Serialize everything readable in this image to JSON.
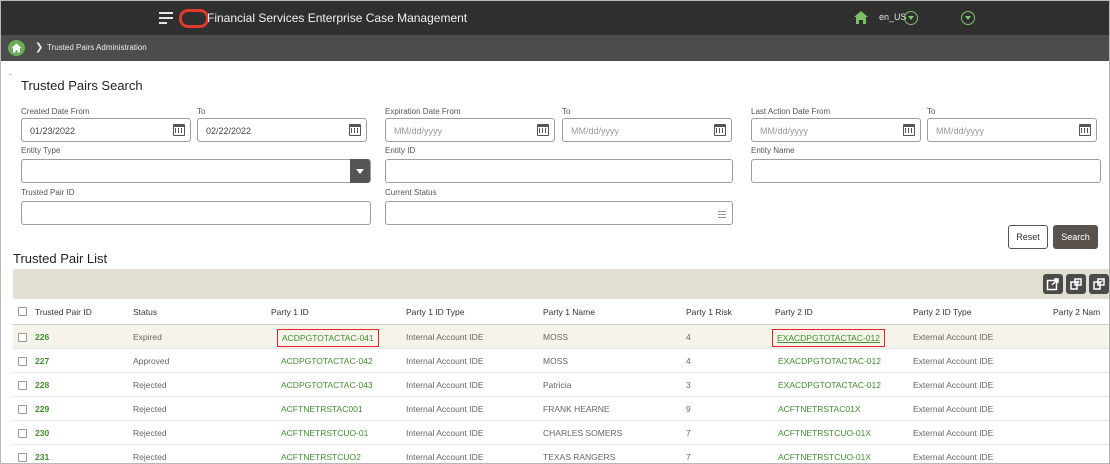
{
  "header": {
    "app_title": "Financial Services Enterprise Case Management",
    "locale": "en_US"
  },
  "breadcrumb": {
    "current": "Trusted Pairs Administration"
  },
  "search": {
    "title": "Trusted Pairs Search",
    "created_from": {
      "label": "Created Date From",
      "value": "01/23/2022"
    },
    "created_to": {
      "label": "To",
      "value": "02/22/2022"
    },
    "expiration_from": {
      "label": "Expiration Date From",
      "placeholder": "MM/dd/yyyy"
    },
    "expiration_to": {
      "label": "To",
      "placeholder": "MM/dd/yyyy"
    },
    "last_action_from": {
      "label": "Last Action Date From",
      "placeholder": "MM/dd/yyyy"
    },
    "last_action_to": {
      "label": "To",
      "placeholder": "MM/dd/yyyy"
    },
    "entity_type": {
      "label": "Entity Type",
      "value": ""
    },
    "entity_id": {
      "label": "Entity ID",
      "value": ""
    },
    "entity_name": {
      "label": "Entity Name",
      "value": ""
    },
    "trusted_pair_id": {
      "label": "Trusted Pair ID",
      "value": ""
    },
    "current_status": {
      "label": "Current Status",
      "value": ""
    },
    "reset_label": "Reset",
    "search_label": "Search"
  },
  "list": {
    "title": "Trusted Pair List",
    "columns": [
      "Trusted Pair ID",
      "Status",
      "Party 1 ID",
      "Party 1 ID Type",
      "Party 1 Name",
      "Party 1 Risk",
      "Party 2 ID",
      "Party 2 ID Type",
      "Party 2 Nam"
    ],
    "rows": [
      {
        "id": "226",
        "status": "Expired",
        "p1id": "ACDPGTOTACTAC-041",
        "p1type": "Internal Account IDE",
        "p1name": "MOSS",
        "p1risk": "4",
        "p2id": "EXACDPGTOTACTAC-012",
        "p2type": "External Account IDE"
      },
      {
        "id": "227",
        "status": "Approved",
        "p1id": "ACDPGTOTACTAC-042",
        "p1type": "Internal Account IDE",
        "p1name": "MOSS",
        "p1risk": "4",
        "p2id": "EXACDPGTOTACTAC-012",
        "p2type": "External Account IDE"
      },
      {
        "id": "228",
        "status": "Rejected",
        "p1id": "ACDPGTOTACTAC-043",
        "p1type": "Internal Account IDE",
        "p1name": "Patricia",
        "p1risk": "3",
        "p2id": "EXACDPGTOTACTAC-012",
        "p2type": "External Account IDE"
      },
      {
        "id": "229",
        "status": "Rejected",
        "p1id": "ACFTNETRSTAC001",
        "p1type": "Internal Account IDE",
        "p1name": "FRANK HEARNE",
        "p1risk": "9",
        "p2id": "ACFTNETRSTAC01X",
        "p2type": "External Account IDE"
      },
      {
        "id": "230",
        "status": "Rejected",
        "p1id": "ACFTNETRSTCUO-01",
        "p1type": "Internal Account IDE",
        "p1name": "CHARLES SOMERS",
        "p1risk": "7",
        "p2id": "ACFTNETRSTCUO-01X",
        "p2type": "External Account IDE"
      },
      {
        "id": "231",
        "status": "Rejected",
        "p1id": "ACFTNETRSTCUO2",
        "p1type": "Internal Account IDE",
        "p1name": "TEXAS RANGERS",
        "p1risk": "7",
        "p2id": "ACFTNETRSTCUO-01X",
        "p2type": "External Account IDE"
      }
    ]
  },
  "icons": {
    "home": "home-icon",
    "menu": "hamburger-icon",
    "calendar": "calendar-icon",
    "export": "export-icon",
    "toolbar_2": "add-pair-icon",
    "toolbar_3": "edit-pair-icon"
  },
  "colors": {
    "header_bg": "#2f2f2f",
    "breadcrumb_bg": "#4c4c4c",
    "accent_green": "#3f8f2e",
    "logo_red": "#e03a2a",
    "toolbar_bg": "#e2dfd0",
    "highlight_border": "#e0242a"
  }
}
